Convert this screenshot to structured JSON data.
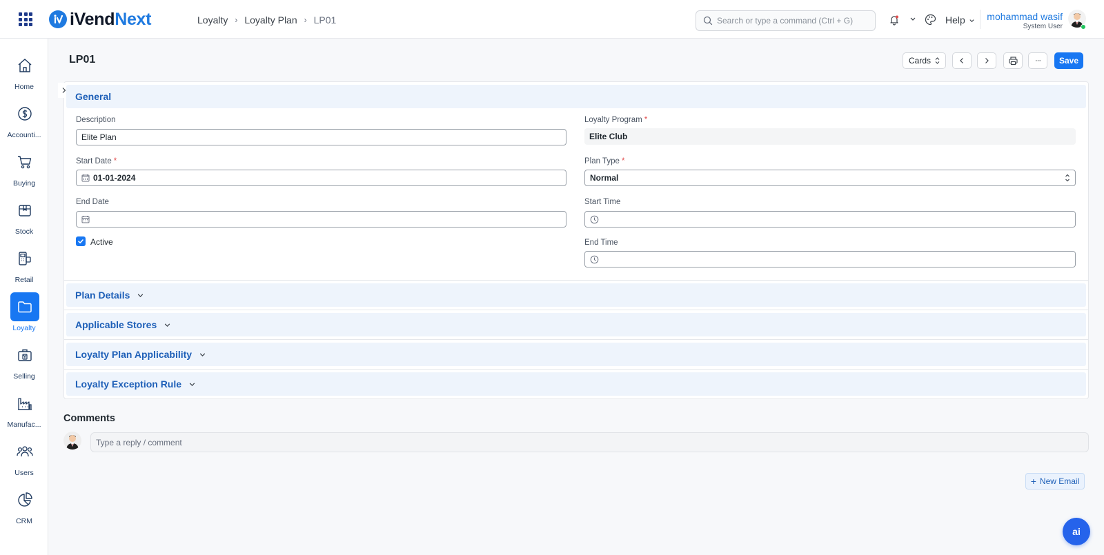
{
  "app": {
    "logo_text_part1": "iVend",
    "logo_text_part2": "Next",
    "brand_color": "#1f7ae0"
  },
  "breadcrumb": [
    "Loyalty",
    "Loyalty Plan",
    "LP01"
  ],
  "search": {
    "placeholder": "Search or type a command (Ctrl + G)"
  },
  "header": {
    "help_label": "Help"
  },
  "user": {
    "name": "mohammad wasif",
    "role": "System User"
  },
  "sidebar": {
    "items": [
      {
        "label": "Home",
        "icon": "home-icon"
      },
      {
        "label": "Accounti...",
        "icon": "dollar-icon"
      },
      {
        "label": "Buying",
        "icon": "cart-icon"
      },
      {
        "label": "Stock",
        "icon": "box-icon"
      },
      {
        "label": "Retail",
        "icon": "pos-icon"
      },
      {
        "label": "Loyalty",
        "icon": "folder-icon",
        "active": true
      },
      {
        "label": "Selling",
        "icon": "briefcase-icon"
      },
      {
        "label": "Manufac...",
        "icon": "factory-icon"
      },
      {
        "label": "Users",
        "icon": "users-icon"
      },
      {
        "label": "CRM",
        "icon": "pie-chart-icon"
      }
    ]
  },
  "page": {
    "title": "LP01",
    "view_label": "Cards",
    "save_label": "Save",
    "more_label": "···"
  },
  "sections": {
    "general": "General",
    "plan_details": "Plan Details",
    "applicable_stores": "Applicable Stores",
    "applicability": "Loyalty Plan Applicability",
    "exception": "Loyalty Exception Rule"
  },
  "form": {
    "description_label": "Description",
    "description_value": "Elite Plan",
    "loyalty_program_label": "Loyalty Program",
    "loyalty_program_value": "Elite Club",
    "start_date_label": "Start Date",
    "start_date_value": "01-01-2024",
    "plan_type_label": "Plan Type",
    "plan_type_value": "Normal",
    "end_date_label": "End Date",
    "end_date_value": "",
    "start_time_label": "Start Time",
    "start_time_value": "",
    "active_label": "Active",
    "active_checked": true,
    "end_time_label": "End Time",
    "end_time_value": "",
    "required_mark": "*"
  },
  "comments": {
    "title": "Comments",
    "placeholder": "Type a reply / comment"
  },
  "actions": {
    "new_email_plus": "+",
    "new_email_label": "New Email",
    "ai_label": "ai"
  }
}
